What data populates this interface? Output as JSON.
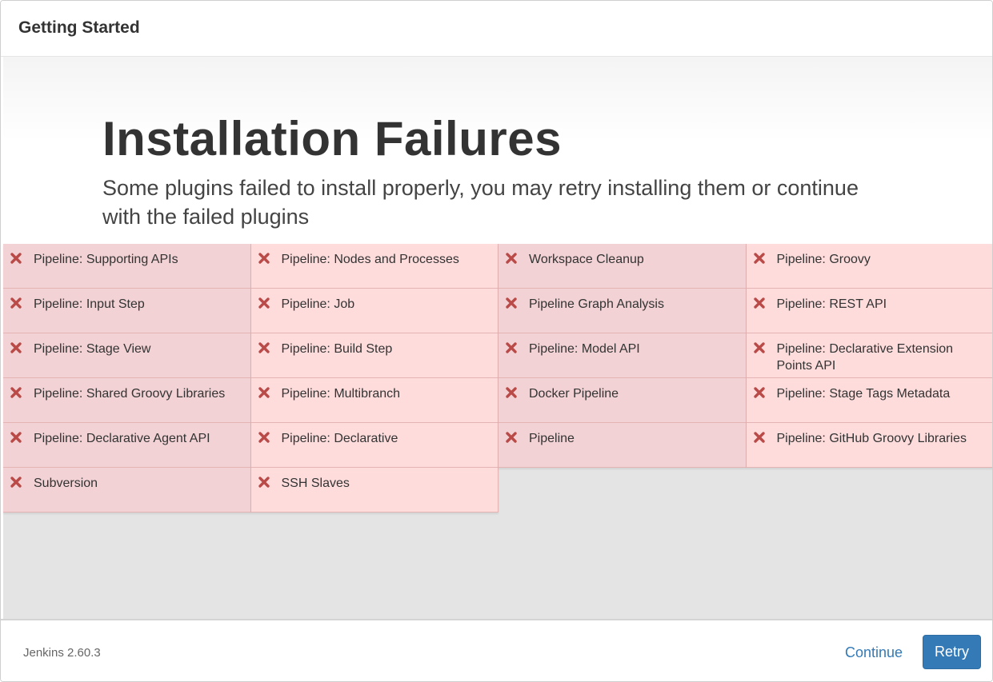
{
  "header": {
    "title": "Getting Started"
  },
  "hero": {
    "title": "Installation Failures",
    "subtitle": "Some plugins failed to install properly, you may retry installing them or continue with the failed plugins"
  },
  "colors": {
    "status_failed": "#b94a48",
    "cell_dark": "#f2d2d4",
    "cell_light": "#ffdcdc",
    "primary": "#337ab7"
  },
  "plugin_columns": [
    {
      "shade": "dark",
      "status_icon": "failed-x-icon",
      "items": [
        "Pipeline: Supporting APIs",
        "Pipeline: Input Step",
        "Pipeline: Stage View",
        "Pipeline: Shared Groovy Libraries",
        "Pipeline: Declarative Agent API",
        "Subversion"
      ]
    },
    {
      "shade": "light",
      "status_icon": "failed-x-icon",
      "items": [
        "Pipeline: Nodes and Processes",
        "Pipeline: Job",
        "Pipeline: Build Step",
        "Pipeline: Multibranch",
        "Pipeline: Declarative",
        "SSH Slaves"
      ]
    },
    {
      "shade": "dark",
      "status_icon": "failed-x-icon",
      "items": [
        "Workspace Cleanup",
        "Pipeline Graph Analysis",
        "Pipeline: Model API",
        "Docker Pipeline",
        "Pipeline"
      ]
    },
    {
      "shade": "light",
      "status_icon": "failed-x-icon",
      "items": [
        "Pipeline: Groovy",
        "Pipeline: REST API",
        "Pipeline: Declarative Extension Points API",
        "Pipeline: Stage Tags Metadata",
        "Pipeline: GitHub Groovy Libraries"
      ]
    }
  ],
  "footer": {
    "version": "Jenkins 2.60.3",
    "continue_label": "Continue",
    "retry_label": "Retry"
  }
}
